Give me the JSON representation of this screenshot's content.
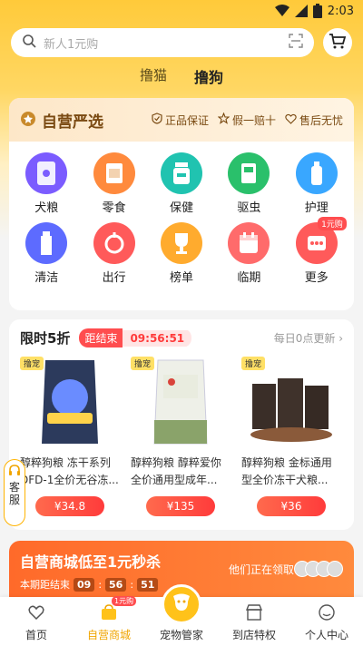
{
  "status_bar": {
    "time": "2:03"
  },
  "search": {
    "placeholder": "新人1元购"
  },
  "pet_tabs": [
    {
      "label": "撸猫",
      "active": false
    },
    {
      "label": "撸狗",
      "active": true
    }
  ],
  "self_operated": {
    "title": "自营严选",
    "guarantees": [
      "正品保证",
      "假一赔十",
      "售后无忧"
    ],
    "categories": [
      {
        "label": "犬粮",
        "color": "#7b5cff"
      },
      {
        "label": "零食",
        "color": "#ff8a3d"
      },
      {
        "label": "保健",
        "color": "#20c3b0"
      },
      {
        "label": "驱虫",
        "color": "#2ac06b"
      },
      {
        "label": "护理",
        "color": "#39a7ff"
      },
      {
        "label": "清洁",
        "color": "#5d6bff"
      },
      {
        "label": "出行",
        "color": "#ff5a5a"
      },
      {
        "label": "榜单",
        "color": "#ffab2e"
      },
      {
        "label": "临期",
        "color": "#ff6b6b"
      },
      {
        "label": "更多",
        "color": "#ff5a5a",
        "badge": "1元购"
      }
    ]
  },
  "flash_sale": {
    "title": "限时5折",
    "countdown_label": "距结束",
    "countdown": "09:56:51",
    "update_text": "每日0点更新",
    "products": [
      {
        "tag": "撸宠",
        "name": "醇粹狗粮 冻干系列DFD-1全价无谷冻...",
        "price": "¥34.8"
      },
      {
        "tag": "撸宠",
        "name": "醇粹狗粮 醇粹爱你全价通用型成年...",
        "price": "¥135"
      },
      {
        "tag": "撸宠",
        "name": "醇粹狗粮 金标通用型全价冻干犬粮...",
        "price": "¥36"
      }
    ]
  },
  "service": {
    "label_1": "客",
    "label_2": "服"
  },
  "promo": {
    "title": "自营商城低至1元秒杀",
    "sub_label": "本期距结束",
    "hh": "09",
    "mm": "56",
    "ss": "51",
    "right_text": "他们正在领取"
  },
  "bottom_nav": [
    {
      "label": "首页"
    },
    {
      "label": "自营商城",
      "badge": "1元购"
    },
    {
      "label": "宠物管家"
    },
    {
      "label": "到店特权"
    },
    {
      "label": "个人中心"
    }
  ]
}
